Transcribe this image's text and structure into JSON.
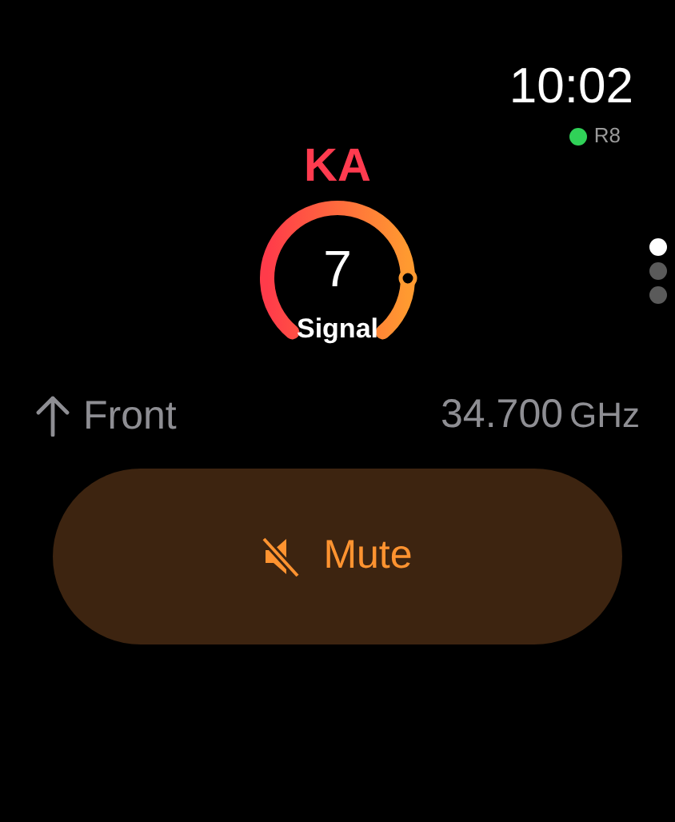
{
  "status": {
    "time": "10:02",
    "device": {
      "label": "R8",
      "color": "#30d158"
    }
  },
  "band": "KA",
  "gauge": {
    "value": "7",
    "label": "Signal"
  },
  "direction": {
    "label": "Front"
  },
  "frequency": {
    "value": "34.700",
    "unit": "GHz"
  },
  "mute_button": {
    "label": "Mute"
  },
  "pages": [
    {
      "selected": true
    },
    {
      "selected": false
    },
    {
      "selected": false
    }
  ]
}
